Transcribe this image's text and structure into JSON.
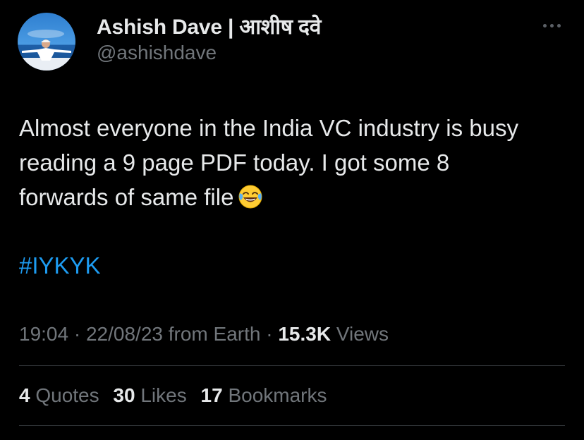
{
  "author": {
    "display_name": "Ashish Dave | आशीष दवे",
    "handle": "@ashishdave"
  },
  "tweet": {
    "lines": [
      "Almost everyone in the India VC industry is busy",
      "reading a 9 page PDF today. I got some 8",
      "forwards of same file"
    ],
    "emoji": "face-with-tears-of-joy",
    "hashtag": "#IYKYK"
  },
  "meta": {
    "time": "19:04",
    "sep1": " · ",
    "date": "22/08/23",
    "source": " from Earth",
    "sep2": " · ",
    "views_count": "15.3K",
    "views_label": " Views"
  },
  "stats": {
    "quotes_count": "4",
    "quotes_label": " Quotes",
    "likes_count": "30",
    "likes_label": " Likes",
    "bookmarks_count": "17",
    "bookmarks_label": " Bookmarks"
  },
  "colors": {
    "background": "#000000",
    "text_primary": "#e7e9ea",
    "text_secondary": "#71767b",
    "link": "#1d9bf0",
    "divider": "#2f3336"
  },
  "icons": {
    "more": "more-dots-icon",
    "avatar": "profile-avatar"
  }
}
